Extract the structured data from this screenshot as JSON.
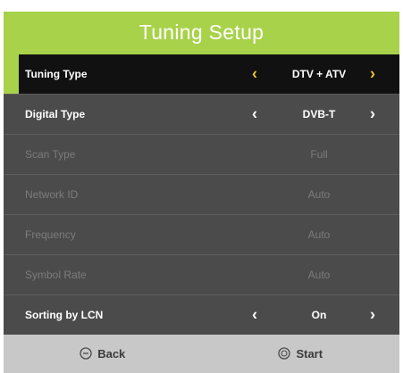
{
  "header": {
    "title": "Tuning Setup"
  },
  "colors": {
    "accent": "#a8d24a",
    "arrow_selected": "#e6c530",
    "panel_bg": "#4b4b4b",
    "footer_bg": "#c8c8c8"
  },
  "rows": [
    {
      "label": "Tuning Type",
      "value": "DTV + ATV",
      "enabled": true,
      "selected": true
    },
    {
      "label": "Digital Type",
      "value": "DVB-T",
      "enabled": true,
      "selected": false
    },
    {
      "label": "Scan Type",
      "value": "Full",
      "enabled": false,
      "selected": false
    },
    {
      "label": "Network ID",
      "value": "Auto",
      "enabled": false,
      "selected": false
    },
    {
      "label": "Frequency",
      "value": "Auto",
      "enabled": false,
      "selected": false
    },
    {
      "label": "Symbol Rate",
      "value": "Auto",
      "enabled": false,
      "selected": false
    },
    {
      "label": "Sorting by LCN",
      "value": "On",
      "enabled": true,
      "selected": false
    }
  ],
  "arrows": {
    "left": "‹",
    "right": "›"
  },
  "footer": {
    "back_label": "Back",
    "start_label": "Start",
    "back_icon": "minus-circle-icon",
    "start_icon": "ok-circle-icon"
  }
}
